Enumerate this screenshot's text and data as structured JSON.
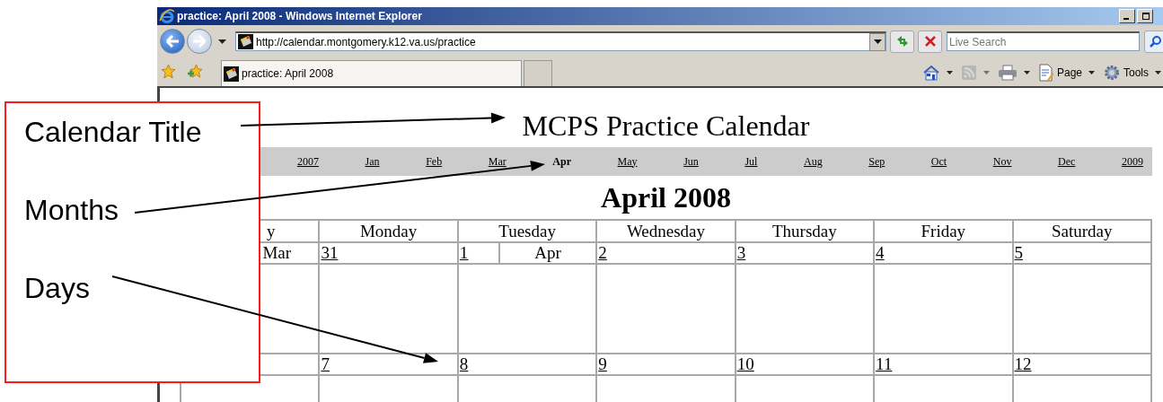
{
  "window": {
    "title": "practice: April 2008 - Windows Internet Explorer"
  },
  "address_bar": {
    "url": "http://calendar.montgomery.k12.va.us/practice"
  },
  "search": {
    "placeholder": "Live Search"
  },
  "tabs": [
    {
      "label": "practice: April 2008",
      "selected": true
    }
  ],
  "command_bar": [
    {
      "kind": "home",
      "disabled": false
    },
    {
      "kind": "feeds",
      "disabled": true
    },
    {
      "kind": "print",
      "disabled": false
    },
    {
      "kind": "page",
      "label": "Page",
      "disabled": false
    },
    {
      "kind": "tools",
      "label": "Tools",
      "disabled": false
    }
  ],
  "page": {
    "title": "MCPS Practice Calendar",
    "nav": [
      {
        "label": "2007",
        "selected": false
      },
      {
        "label": "Jan",
        "selected": false
      },
      {
        "label": "Feb",
        "selected": false
      },
      {
        "label": "Mar",
        "selected": false
      },
      {
        "label": "Apr",
        "selected": true
      },
      {
        "label": "May",
        "selected": false
      },
      {
        "label": "Jun",
        "selected": false
      },
      {
        "label": "Jul",
        "selected": false
      },
      {
        "label": "Aug",
        "selected": false
      },
      {
        "label": "Sep",
        "selected": false
      },
      {
        "label": "Oct",
        "selected": false
      },
      {
        "label": "Nov",
        "selected": false
      },
      {
        "label": "Dec",
        "selected": false
      },
      {
        "label": "2009",
        "selected": false
      }
    ],
    "month_title": "April 2008",
    "weekdays": [
      "y",
      "Monday",
      "Tuesday",
      "Wednesday",
      "Thursday",
      "Friday",
      "Saturday"
    ],
    "weeks": [
      [
        {
          "month": "Mar"
        },
        {
          "day": "31"
        },
        {
          "day": "1",
          "month": "Apr"
        },
        {
          "day": "2"
        },
        {
          "day": "3"
        },
        {
          "day": "4"
        },
        {
          "day": "5"
        }
      ],
      [
        {
          "day": "7"
        },
        {
          "day": "8"
        },
        {
          "day": "9"
        },
        {
          "day": "10"
        },
        {
          "day": "11"
        },
        {
          "day": "12"
        }
      ]
    ]
  },
  "annotations": {
    "labels": [
      "Calendar Title",
      "Months",
      "Days"
    ]
  }
}
